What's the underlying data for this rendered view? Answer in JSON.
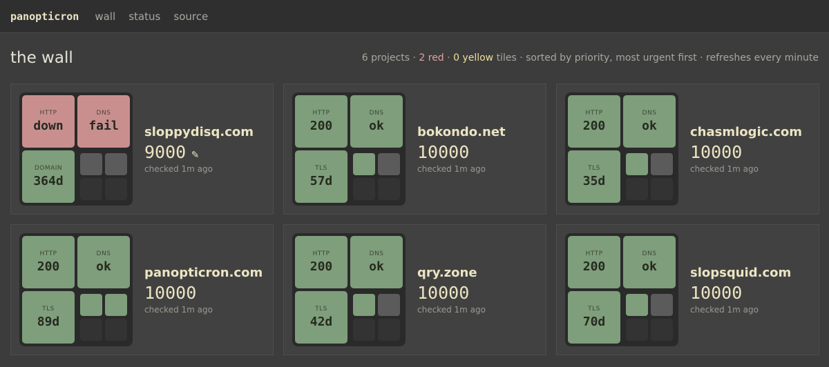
{
  "nav": {
    "brand": "panopticron",
    "links": [
      "wall",
      "status",
      "source"
    ]
  },
  "header": {
    "title": "the wall",
    "summary": {
      "projects": "6 projects",
      "sep1": " · ",
      "red": "2 red",
      "sep2": " · ",
      "yellow": "0 yellow",
      "rest": " tiles · sorted by priority, most urgent first · refreshes every minute"
    }
  },
  "projects": [
    {
      "domain": "sloppydisq.com",
      "score": "9000",
      "edit_icon": "✎",
      "checked": "checked 1m ago",
      "tiles": [
        {
          "label": "HTTP",
          "value": "down",
          "state": "bad"
        },
        {
          "label": "DNS",
          "value": "fail",
          "state": "bad"
        },
        {
          "label": "DOMAIN",
          "value": "364d",
          "state": "ok"
        }
      ],
      "minis": [
        "grey",
        "grey",
        "empty",
        "empty"
      ]
    },
    {
      "domain": "bokondo.net",
      "score": "10000",
      "checked": "checked 1m ago",
      "tiles": [
        {
          "label": "HTTP",
          "value": "200",
          "state": "ok"
        },
        {
          "label": "DNS",
          "value": "ok",
          "state": "ok"
        },
        {
          "label": "TLS",
          "value": "57d",
          "state": "ok"
        }
      ],
      "minis": [
        "green",
        "grey",
        "empty",
        "empty"
      ]
    },
    {
      "domain": "chasmlogic.com",
      "score": "10000",
      "checked": "checked 1m ago",
      "tiles": [
        {
          "label": "HTTP",
          "value": "200",
          "state": "ok"
        },
        {
          "label": "DNS",
          "value": "ok",
          "state": "ok"
        },
        {
          "label": "TLS",
          "value": "35d",
          "state": "ok"
        }
      ],
      "minis": [
        "green",
        "grey",
        "empty",
        "empty"
      ]
    },
    {
      "domain": "panopticron.com",
      "score": "10000",
      "checked": "checked 1m ago",
      "tiles": [
        {
          "label": "HTTP",
          "value": "200",
          "state": "ok"
        },
        {
          "label": "DNS",
          "value": "ok",
          "state": "ok"
        },
        {
          "label": "TLS",
          "value": "89d",
          "state": "ok"
        }
      ],
      "minis": [
        "green",
        "green",
        "empty",
        "empty"
      ]
    },
    {
      "domain": "qry.zone",
      "score": "10000",
      "checked": "checked 1m ago",
      "tiles": [
        {
          "label": "HTTP",
          "value": "200",
          "state": "ok"
        },
        {
          "label": "DNS",
          "value": "ok",
          "state": "ok"
        },
        {
          "label": "TLS",
          "value": "42d",
          "state": "ok"
        }
      ],
      "minis": [
        "green",
        "grey",
        "empty",
        "empty"
      ]
    },
    {
      "domain": "slopsquid.com",
      "score": "10000",
      "checked": "checked 1m ago",
      "tiles": [
        {
          "label": "HTTP",
          "value": "200",
          "state": "ok"
        },
        {
          "label": "DNS",
          "value": "ok",
          "state": "ok"
        },
        {
          "label": "TLS",
          "value": "70d",
          "state": "ok"
        }
      ],
      "minis": [
        "green",
        "grey",
        "empty",
        "empty"
      ]
    }
  ]
}
